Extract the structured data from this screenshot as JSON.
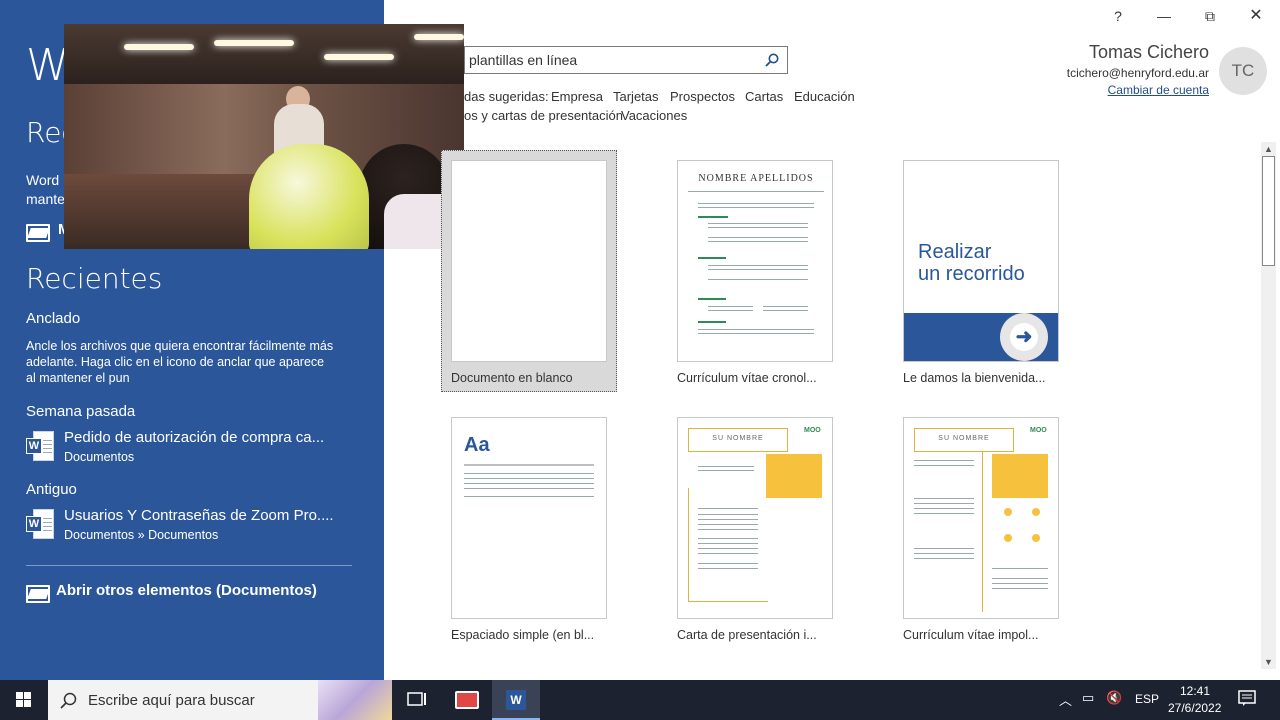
{
  "left": {
    "word_title": "W",
    "recent_top": "Rec",
    "word_message": "Word\nmante",
    "more_docs_label": "M",
    "recientes_heading": "Recientes",
    "anclado_heading": "Anclado",
    "anclado_message": "Ancle los archivos que quiera encontrar fácilmente más adelante. Haga clic en el icono de anclar que aparece al mantener el pun",
    "semana_heading": "Semana pasada",
    "antiguo_heading": "Antiguo",
    "files": [
      {
        "title": "Pedido de autorización de compra ca...",
        "path": "Documentos"
      },
      {
        "title": "Usuarios Y Contraseñas de Zoom Pro....",
        "path": "Documentos » Documentos"
      }
    ],
    "open_other": "Abrir otros elementos (Documentos)"
  },
  "window": {
    "help": "?",
    "minimize": "—",
    "restore": "⧉",
    "close": "✕"
  },
  "search": {
    "value": "plantillas en línea",
    "suggestions_label": "das sugeridas:",
    "suggestions": [
      "Empresa",
      "Tarjetas",
      "Prospectos",
      "Cartas",
      "Educación"
    ],
    "suggestions_row2": [
      "os y cartas de presentación",
      "Vacaciones"
    ]
  },
  "account": {
    "name": "Tomas Cichero",
    "email": "tcichero@henryford.edu.ar",
    "switch": "Cambiar de cuenta",
    "initials": "TC"
  },
  "templates": [
    {
      "label": "Documento en blanco"
    },
    {
      "label": "Currículum vítae cronol...",
      "thumb_name": "NOMBRE APELLIDOS"
    },
    {
      "label": "Le damos la bienvenida...",
      "thumb_text": "Realizar\nun recorrido"
    },
    {
      "label": "Espaciado simple (en bl...",
      "thumb_text": "Aa"
    },
    {
      "label": "Carta de presentación i...",
      "thumb_name": "SU NOMBRE",
      "brand": "MOO"
    },
    {
      "label": "Currículum vítae impol...",
      "thumb_name": "SU NOMBRE",
      "brand": "MOO"
    }
  ],
  "taskbar": {
    "search_placeholder": "Escribe aquí para buscar",
    "lang": "ESP",
    "time": "12:41",
    "date": "27/6/2022"
  },
  "colors": {
    "word_blue": "#2b579a",
    "taskbar": "#1c2230"
  }
}
